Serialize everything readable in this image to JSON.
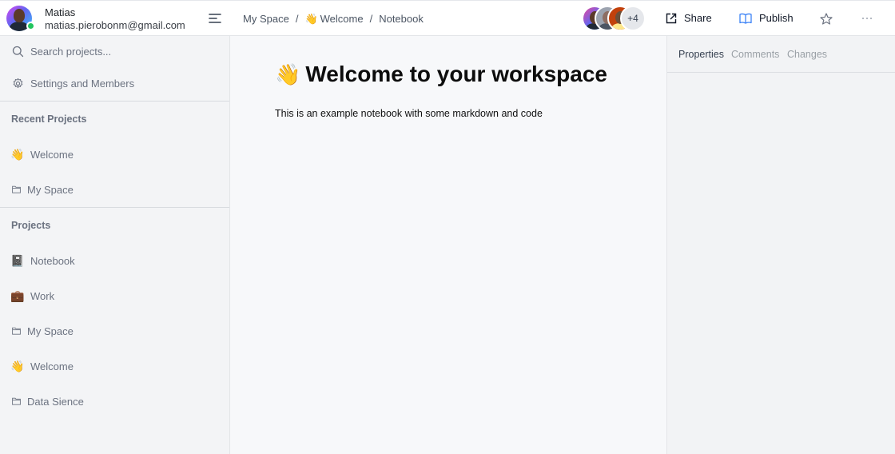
{
  "user": {
    "name": "Matias",
    "email": "matias.pierobonm@gmail.com"
  },
  "sidebar": {
    "search_label": "Search projects...",
    "settings_label": "Settings and Members",
    "recent_title": "Recent Projects",
    "recent": [
      {
        "icon": "👋",
        "label": "Welcome"
      },
      {
        "icon": "folder-icon",
        "label": "My Space"
      }
    ],
    "projects_title": "Projects",
    "projects": [
      {
        "icon": "📓",
        "label": "Notebook"
      },
      {
        "icon": "💼",
        "label": "Work"
      },
      {
        "icon": "folder-icon",
        "label": "My Space"
      },
      {
        "icon": "👋",
        "label": "Welcome"
      },
      {
        "icon": "folder-icon",
        "label": "Data Sience"
      }
    ]
  },
  "topbar": {
    "breadcrumb": {
      "space": "My Space",
      "sep": "/",
      "page_icon": "👋",
      "page": "Welcome",
      "current": "Notebook"
    },
    "extra_collaborators": "+4",
    "share_label": "Share",
    "publish_label": "Publish"
  },
  "main": {
    "title_icon": "👋",
    "title": "Welcome to your workspace",
    "body": "This is an example notebook with some markdown and code"
  },
  "right_panel": {
    "tabs": [
      "Properties",
      "Comments",
      "Changes"
    ],
    "active_tab": "Properties"
  },
  "colors": {
    "online": "#22c55e",
    "publish_icon": "#3b82f6",
    "sidebar_bg": "#f3f4f6"
  }
}
